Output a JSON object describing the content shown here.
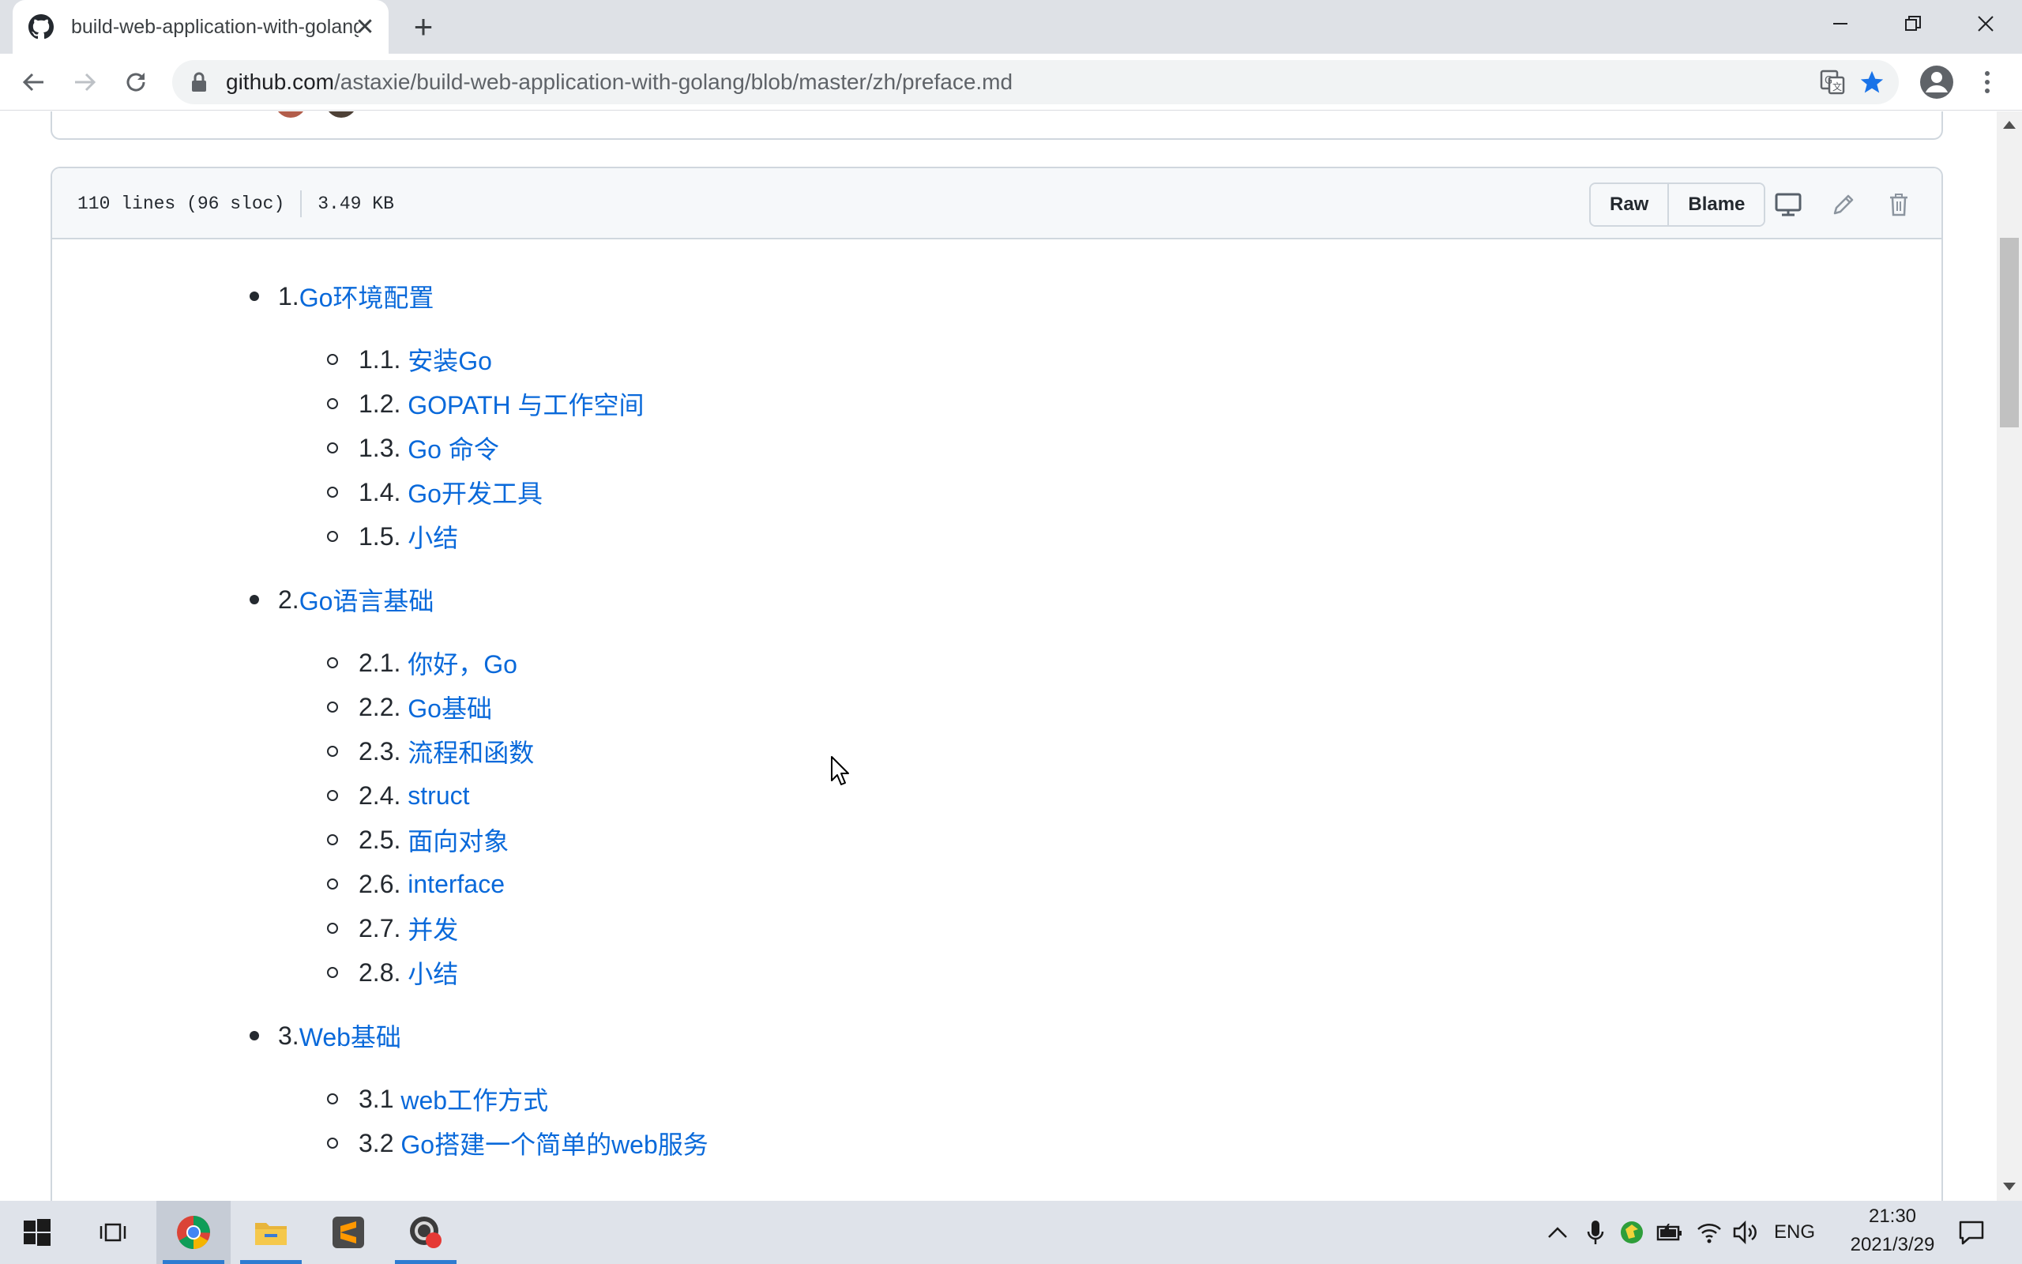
{
  "browser": {
    "tab_title": "build-web-application-with-golang",
    "url_host": "github.com",
    "url_path": "/astaxie/build-web-application-with-golang/blob/master/zh/preface.md"
  },
  "file": {
    "lines_info": "110 lines (96 sloc)",
    "size": "3.49 KB",
    "raw_label": "Raw",
    "blame_label": "Blame"
  },
  "toc": [
    {
      "num": "1.",
      "title": "Go环境配置",
      "children": [
        {
          "num": "1.1. ",
          "title": "安装Go"
        },
        {
          "num": "1.2. ",
          "title": "GOPATH 与工作空间"
        },
        {
          "num": "1.3. ",
          "title": "Go 命令"
        },
        {
          "num": "1.4. ",
          "title": "Go开发工具"
        },
        {
          "num": "1.5. ",
          "title": "小结"
        }
      ]
    },
    {
      "num": "2.",
      "title": "Go语言基础",
      "children": [
        {
          "num": "2.1. ",
          "title": "你好，Go"
        },
        {
          "num": "2.2. ",
          "title": "Go基础"
        },
        {
          "num": "2.3. ",
          "title": "流程和函数"
        },
        {
          "num": "2.4. ",
          "title": "struct"
        },
        {
          "num": "2.5. ",
          "title": "面向对象"
        },
        {
          "num": "2.6. ",
          "title": "interface"
        },
        {
          "num": "2.7. ",
          "title": "并发"
        },
        {
          "num": "2.8. ",
          "title": "小结"
        }
      ]
    },
    {
      "num": "3.",
      "title": "Web基础",
      "children": [
        {
          "num": "3.1 ",
          "title": "web工作方式"
        },
        {
          "num": "3.2 ",
          "title": "Go搭建一个简单的web服务"
        }
      ]
    }
  ],
  "taskbar": {
    "language": "ENG",
    "time": "21:30",
    "date": "2021/3/29"
  },
  "colors": {
    "link": "#0969da",
    "text": "#24292f",
    "border": "#d0d7de",
    "taskbar": "#dfe3ea"
  }
}
